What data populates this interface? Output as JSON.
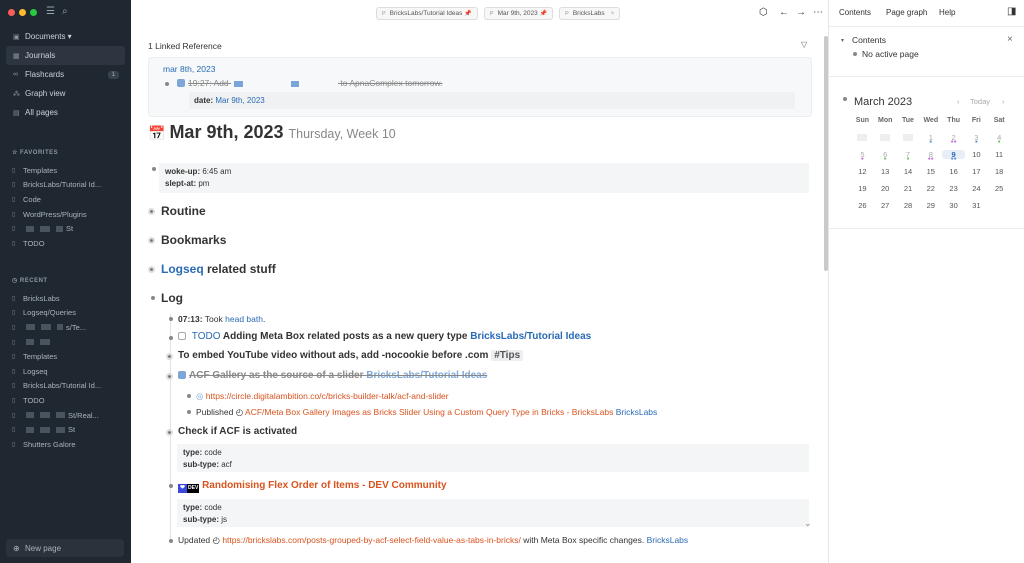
{
  "sidebar": {
    "nav": [
      {
        "icon": "▣",
        "label": "Documents ▾"
      },
      {
        "icon": "▦",
        "label": "Journals",
        "active": true
      },
      {
        "icon": "∞",
        "label": "Flashcards",
        "count": "1"
      },
      {
        "icon": "⁂",
        "label": "Graph view"
      },
      {
        "icon": "▤",
        "label": "All pages"
      }
    ],
    "favorites_heading": "FAVORITES",
    "favorites": [
      "Templates",
      "BricksLabs/Tutorial Id...",
      "Code",
      "WordPress/Plugins",
      "St",
      "TODO"
    ],
    "recent_heading": "RECENT",
    "recent": [
      "BricksLabs",
      "Logseq/Queries",
      "s/Te...",
      "",
      "Templates",
      "Logseq",
      "BricksLabs/Tutorial Id...",
      "TODO",
      "St/Real...",
      "St",
      "Shutters Galore"
    ],
    "new_page": "New page"
  },
  "tabs": [
    {
      "label": "BricksLabs/Tutorial Ideas",
      "pinned": true
    },
    {
      "label": "Mar 9th, 2023",
      "pinned": true
    },
    {
      "label": "BricksLabs",
      "close": "×"
    }
  ],
  "tab_prefix": "P",
  "linked": {
    "title": "1 Linked Reference",
    "date": "mar 8th, 2023",
    "line_start": "19:27: Add",
    "line_end": "to ApnaComplex tomorrow.",
    "prop_key": "date:",
    "prop_val": "Mar 9th, 2023"
  },
  "page": {
    "title": "Mar 9th, 2023",
    "subtitle": "Thursday, Week 10",
    "props": [
      {
        "k": "woke-up:",
        "v": "6:45 am"
      },
      {
        "k": "slept-at:",
        "v": "pm"
      }
    ],
    "routine": "Routine",
    "bookmarks": "Bookmarks",
    "logseq_link": "Logseq",
    "logseq_rest": "related stuff",
    "log": "Log",
    "b1_time": "07:13:",
    "b1_text": "Took",
    "b1_link": "head bath",
    "b2_kw": "TODO",
    "b2_text": "Adding Meta Box related posts as a new query type",
    "b2_link": "BricksLabs/Tutorial Ideas",
    "b3_text": "To embed YouTube video without ads, add -nocookie before .com",
    "b3_tag": "#Tips",
    "b4_text": "ACF Gallery as the source of a slider",
    "b4_link": "BricksLabs/Tutorial Ideas",
    "b4_url": "https://circle.digitalambition.co/c/bricks-builder-talk/acf-and-slider",
    "b4_pub_label": "Published",
    "b4_pub_link": "ACF/Meta Box Gallery Images as Bricks Slider Using a Custom Query Type in Bricks - BricksLabs",
    "b4_pub_tag": "BricksLabs",
    "b5_text": "Check if ACF is activated",
    "b5_props": [
      {
        "k": "type:",
        "v": "code"
      },
      {
        "k": "sub-type:",
        "v": "acf"
      }
    ],
    "b6_badge": "DEV",
    "b6_link": "Randomising Flex Order of Items - DEV Community",
    "b6_props": [
      {
        "k": "type:",
        "v": "code"
      },
      {
        "k": "sub-type:",
        "v": "js"
      }
    ],
    "b7_label": "Updated",
    "b7_link": "https://brickslabs.com/posts-grouped-by-acf-select-field-value-as-tabs-in-bricks/",
    "b7_rest": "with Meta Box specific changes.",
    "b7_tag": "BricksLabs"
  },
  "right": {
    "tabs": [
      "Contents",
      "Page graph",
      "Help"
    ],
    "contents_title": "Contents",
    "no_active": "No active page",
    "cal_title": "March 2023",
    "today": "Today",
    "weekdays": [
      "Sun",
      "Mon",
      "Tue",
      "Wed",
      "Thu",
      "Fri",
      "Sat"
    ],
    "weeks": [
      [
        "",
        "",
        "",
        "1",
        "2",
        "3",
        "4"
      ],
      [
        "5",
        "6",
        "7",
        "8",
        "9",
        "10",
        "11"
      ],
      [
        "12",
        "13",
        "14",
        "15",
        "16",
        "17",
        "18"
      ],
      [
        "19",
        "20",
        "21",
        "22",
        "23",
        "24",
        "25"
      ],
      [
        "26",
        "27",
        "28",
        "29",
        "30",
        "31",
        ""
      ]
    ]
  },
  "colors": {
    "link": "#2a6bb5",
    "orange": "#d9531e",
    "sidebar_bg": "#1f2730"
  }
}
